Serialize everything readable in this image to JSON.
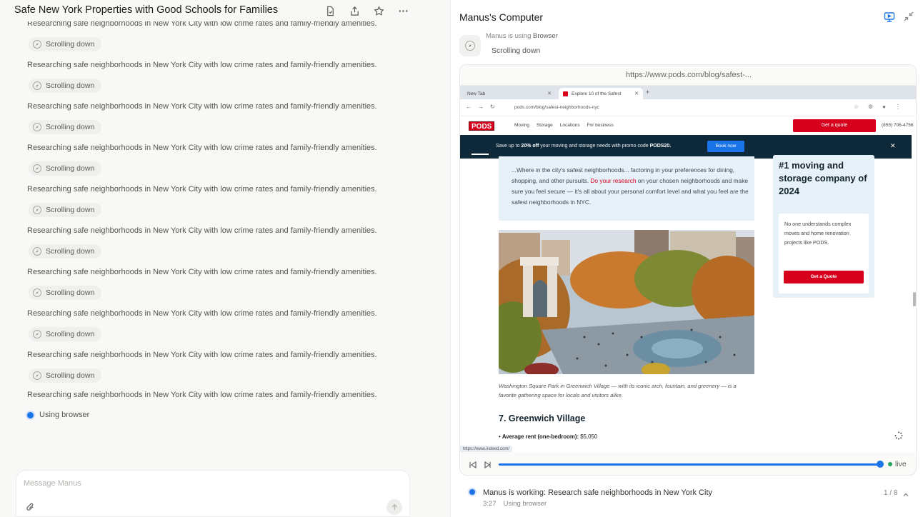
{
  "chat": {
    "title": "Safe New York Properties with Good Schools for Families",
    "header_icons": [
      "file-icon",
      "share-icon",
      "star-icon",
      "more-icon"
    ],
    "steps": [
      {
        "text": "Researching safe neighborhoods in New York City with low crime rates and family-friendly amenities.",
        "action": "Scrolling down"
      },
      {
        "text": "Researching safe neighborhoods in New York City with low crime rates and family-friendly amenities.",
        "action": "Scrolling down"
      },
      {
        "text": "Researching safe neighborhoods in New York City with low crime rates and family-friendly amenities.",
        "action": "Scrolling down"
      },
      {
        "text": "Researching safe neighborhoods in New York City with low crime rates and family-friendly amenities.",
        "action": "Scrolling down"
      },
      {
        "text": "Researching safe neighborhoods in New York City with low crime rates and family-friendly amenities.",
        "action": "Scrolling down"
      },
      {
        "text": "Researching safe neighborhoods in New York City with low crime rates and family-friendly amenities.",
        "action": "Scrolling down"
      },
      {
        "text": "Researching safe neighborhoods in New York City with low crime rates and family-friendly amenities.",
        "action": "Scrolling down"
      },
      {
        "text": "Researching safe neighborhoods in New York City with low crime rates and family-friendly amenities.",
        "action": "Scrolling down"
      },
      {
        "text": "Researching safe neighborhoods in New York City with low crime rates and family-friendly amenities.",
        "action": "Scrolling down"
      }
    ],
    "last_step": "Researching safe neighborhoods in New York City with low crime rates and family-friendly amenities.",
    "status": "Using browser",
    "composer_placeholder": "Message Manus"
  },
  "computer": {
    "title": "Manus's Computer",
    "agent_prefix": "Manus is using",
    "agent_tool": "Browser",
    "agent_action": "Scrolling down",
    "url": "https://www.pods.com/blog/safest-...",
    "browser": {
      "tab1": "New Tab",
      "tab2": "Explore 10 of the Safest",
      "address": "pods.com/blog/safest-neighborhoods-nyc",
      "logo": "PODS",
      "nav_links": [
        "Moving",
        "Storage",
        "Locations",
        "For business"
      ],
      "quote_button": "Get a quote",
      "phone": "(855) 706-4756",
      "promo_prefix": "Save up to ",
      "promo_bold": "20% off",
      "promo_mid": " your moving and storage needs with promo code ",
      "promo_code": "PODS20.",
      "book_button": "Book now",
      "article_text_1": "...Where in the city's safest neighborhoods... factoring in your preferences for dining, shopping, and other pursuits. ",
      "article_link": "Do your research",
      "article_text_2": " on your chosen neighborhoods and make sure you feel secure — it's all about your personal comfort level and what you feel are the safest neighborhoods in NYC.",
      "caption": "Washington Square Park in Greenwich Village — with its iconic arch, fountain, and greenery — is a favorite gathering space for locals and visitors alike.",
      "section_heading": "7. Greenwich Village",
      "bullet_label": "Average rent (one-bedroom):",
      "bullet_value": " $5,050",
      "side_heading": "#1 moving and storage company of 2024",
      "side_text": "No one understands complex moves and home renovation projects like PODS.",
      "side_button": "Get a Quote",
      "status_url": "https://www.indeed.com/"
    },
    "live_label": "live",
    "task": {
      "title": "Manus is working: Research safe neighborhoods in New York City",
      "time": "3:27",
      "tool": "Using browser",
      "count": "1 / 8"
    }
  },
  "colors": {
    "accent": "#1a73e8",
    "pods_red": "#d6001c",
    "promo_bg": "#0e2a3a",
    "live_green": "#22a55b"
  }
}
